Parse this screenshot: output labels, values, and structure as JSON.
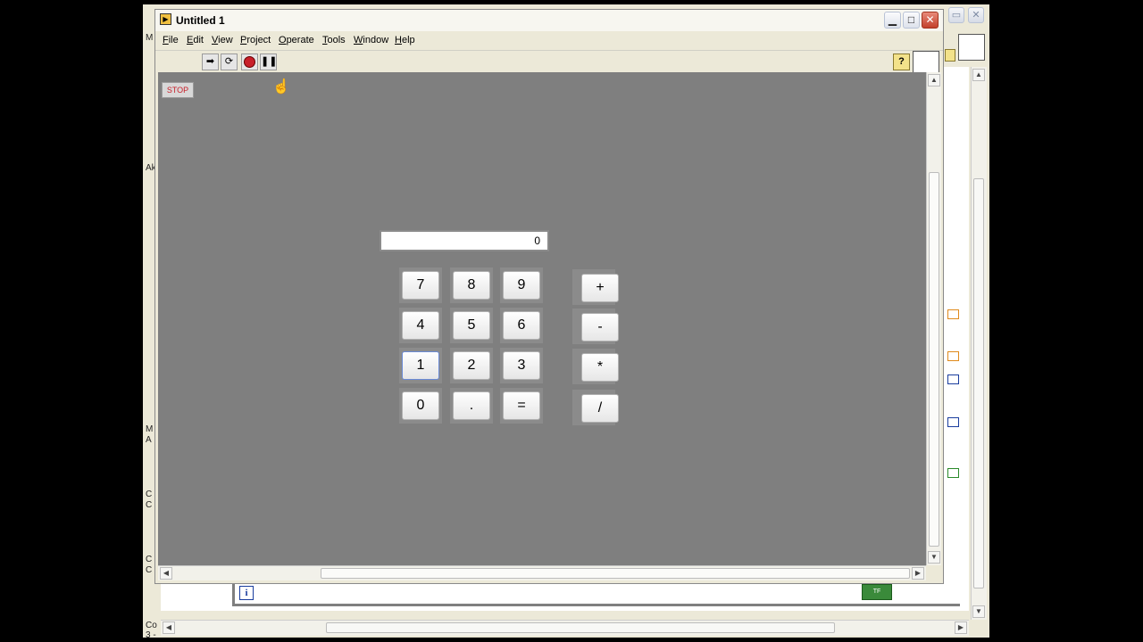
{
  "front_panel": {
    "title": "Untitled 1",
    "menu": [
      "File",
      "Edit",
      "View",
      "Project",
      "Operate",
      "Tools",
      "Window",
      "Help"
    ],
    "menu_underline": [
      "F",
      "E",
      "V",
      "P",
      "O",
      "T",
      "W",
      "H"
    ],
    "menu_rest": [
      "ile",
      "dit",
      "iew",
      "roject",
      "perate",
      "ools",
      "indow",
      "elp"
    ],
    "toolbar": {
      "run_icon": "run-arrow-icon",
      "run_continuous_icon": "run-continuously-icon",
      "abort_icon": "abort-icon",
      "pause_icon": "pause-icon",
      "help_label": "?"
    },
    "stop_button": "STOP",
    "display_value": "0",
    "keypad": {
      "digits": [
        "7",
        "8",
        "9",
        "4",
        "5",
        "6",
        "1",
        "2",
        "3",
        "0",
        ".",
        "="
      ],
      "operators": [
        "+",
        "-",
        "*",
        "/"
      ]
    }
  },
  "block_diagram": {
    "loop_iteration_label": "i",
    "loop_condition_label": "TF",
    "edge_labels": [
      "M",
      "Ak",
      "M",
      "A",
      "C",
      "C",
      "C",
      "C",
      "Co",
      "3 -"
    ]
  },
  "colors": {
    "panel_bg": "#7f7f7f",
    "stop_text": "#c8202a",
    "window_chrome": "#ece9d8",
    "close_button": "#c2412c"
  }
}
